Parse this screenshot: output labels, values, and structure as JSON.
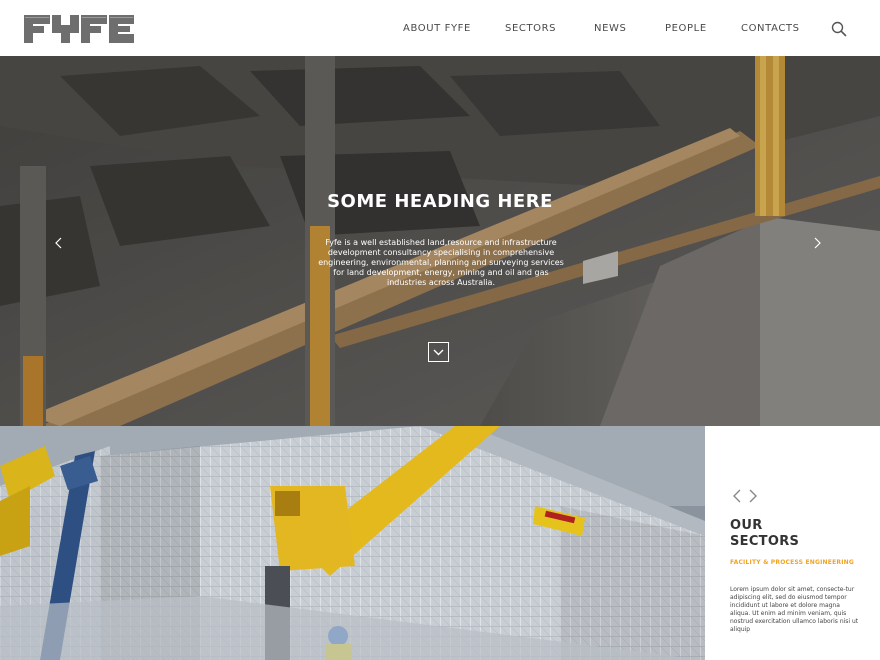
{
  "header": {
    "logo_text": "FYFE",
    "nav": [
      "ABOUT FYFE",
      "SECTORS",
      "NEWS",
      "PEOPLE",
      "CONTACTS"
    ]
  },
  "hero": {
    "title": "SOME HEADING HERE",
    "description": "Fyfe is a well established land,resource and infrastructure development consultancy specialising in comprehensive engineering, environmental, planning and surveying services for land development, energy, mining and oil and gas industries across Australia."
  },
  "sectors": {
    "heading_line1": "OUR",
    "heading_line2": "SECTORS",
    "subheading": "FACILITY & PROCESS ENGINEERING",
    "body": "Lorem ipsum dolor sit amet, consecte-tur adipiscing elit, sed do eiusmod tempor incididunt ut labore et dolore magna aliqua. Ut enim ad minim veniam, quis nostrud exercitation ullamco laboris nisi ut aliquip"
  },
  "colors": {
    "accent": "#f0a322",
    "logo_gray": "#6e6e6e",
    "text_dark": "#333333"
  },
  "icons": {
    "search": "search-icon",
    "hero_prev": "chevron-left-icon",
    "hero_next": "chevron-right-icon",
    "scroll_down": "chevron-down-icon"
  }
}
